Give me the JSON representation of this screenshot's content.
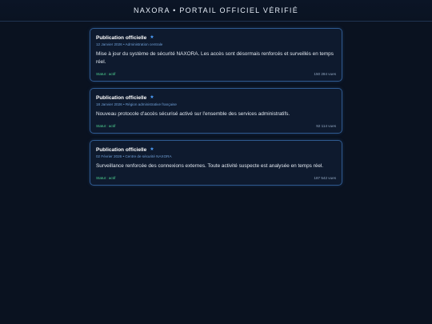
{
  "header": {
    "title": "NAXORA • PORTAIL OFFICIEL VÉRIFIÉ"
  },
  "posts": [
    {
      "title": "Publication officielle",
      "icon": "verified-star-icon",
      "meta": "12 Janvier 2026 • Administration centrale",
      "body": "Mise à jour du système de sécurité NAXORA. Les accès sont désormais renforcés et surveillés en temps réel.",
      "status": "Statut : actif",
      "views": "150 284 vues"
    },
    {
      "title": "Publication officielle",
      "icon": "verified-star-icon",
      "meta": "18 Janvier 2026 • Région administrative française",
      "body": "Nouveau protocole d'accès sécurisé activé sur l'ensemble des services administratifs.",
      "status": "Statut : actif",
      "views": "92 114 vues"
    },
    {
      "title": "Publication officielle",
      "icon": "verified-star-icon",
      "meta": "02 Février 2026 • Centre de sécurité NAXORA",
      "body": "Surveillance renforcée des connexions externes. Toute activité suspecte est analysée en temps réel.",
      "status": "Statut : actif",
      "views": "187 542 vues"
    }
  ],
  "colors": {
    "background": "#0a1220",
    "card_border": "#2f5a90",
    "accent": "#4ea1ff",
    "status": "#4fd392"
  }
}
